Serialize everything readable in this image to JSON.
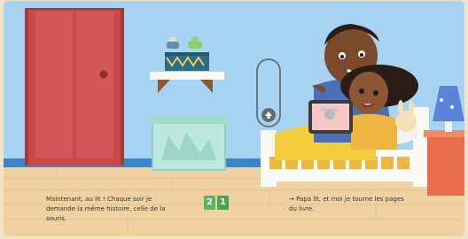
{
  "page": {
    "left_text": "Maintenant, au lit ! Chaque soir je demande la même histoire, celle de la souris.",
    "right_text": "→ Papa lit, et moi je tourne les pages du livre.",
    "page_left": "2",
    "page_right": "1"
  },
  "icons": {
    "navigate": "up-arrow-icon"
  },
  "colors": {
    "wall": "#a9d3f1",
    "floor": "#f1d4a6",
    "door": "#c94848",
    "page_number_bg": "#5db563"
  }
}
